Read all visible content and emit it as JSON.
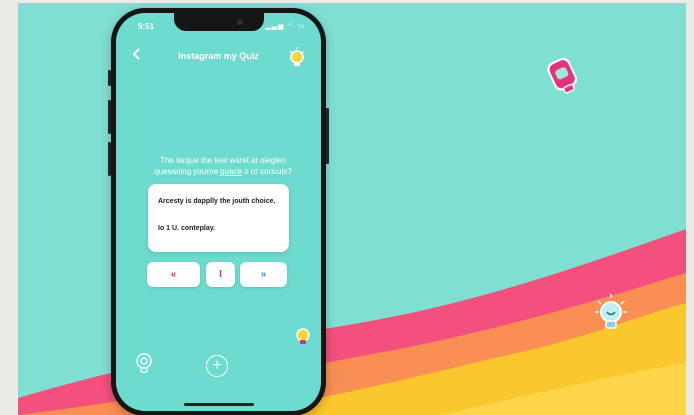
{
  "status_bar": {
    "time": "9:51",
    "icons": "▂▃▅ ◠ ▭"
  },
  "header": {
    "title": "Instagram my Quiz",
    "back_icon": "chevron-left-icon"
  },
  "question": {
    "line1": "The tarque the teal waret at oleglen",
    "line2_start": "quesaning yourne ",
    "line2_link": "quace",
    "line2_end": " o or coricuis?"
  },
  "answers": [
    "Arcesty is dapplly the jouth choice.",
    "Io 1 U. conteplay."
  ],
  "controls": {
    "prev": "«",
    "middle": "I",
    "next": "»"
  },
  "bottom_bar": {
    "add": "+"
  },
  "colors": {
    "background": "#7fdfd3",
    "wave_pink": "#f4507d",
    "wave_orange": "#f98f52",
    "wave_yellow": "#fbc72f",
    "control_pink": "#d1317a",
    "control_blue": "#3b89d4"
  }
}
